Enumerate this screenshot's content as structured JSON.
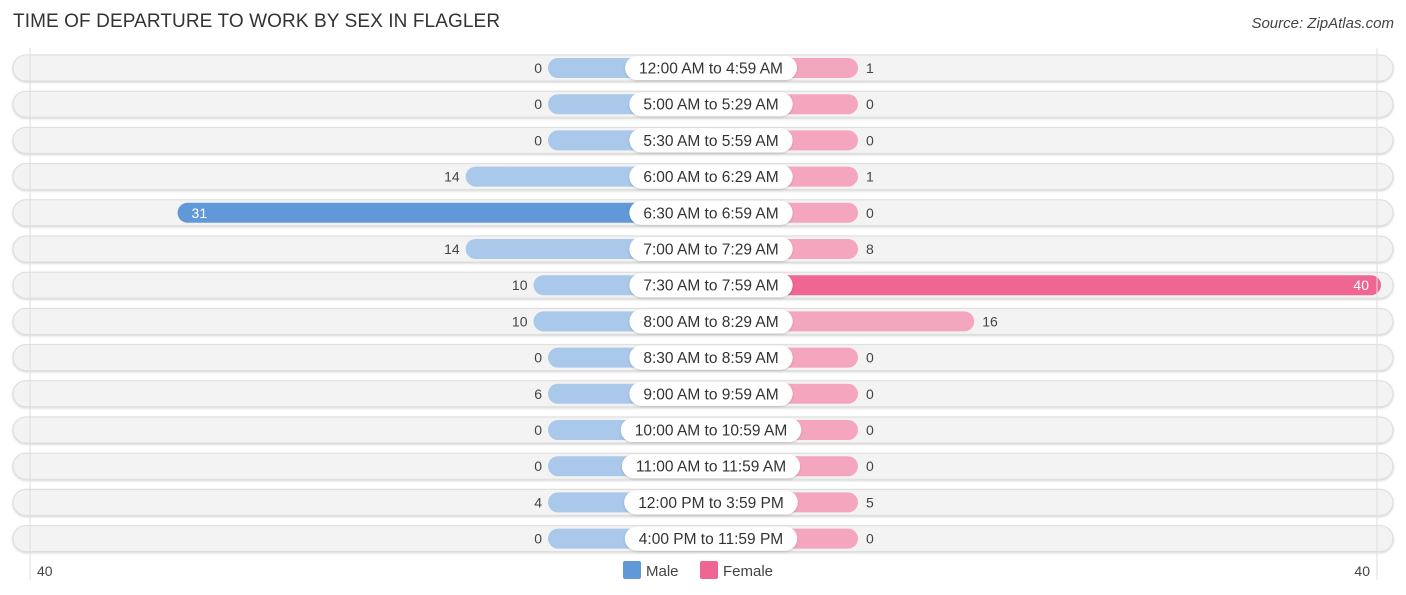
{
  "header": {
    "title": "TIME OF DEPARTURE TO WORK BY SEX IN FLAGLER",
    "source": "Source: ZipAtlas.com"
  },
  "colors": {
    "male_light": "#a9c8ea",
    "male_strong": "#6199d8",
    "female_light": "#f5a6bf",
    "female_strong": "#f06692",
    "row_bg": "#f3f3f3"
  },
  "chart_data": {
    "type": "bar",
    "orientation": "horizontal-diverging",
    "title": "TIME OF DEPARTURE TO WORK BY SEX IN FLAGLER",
    "categories": [
      "12:00 AM to 4:59 AM",
      "5:00 AM to 5:29 AM",
      "5:30 AM to 5:59 AM",
      "6:00 AM to 6:29 AM",
      "6:30 AM to 6:59 AM",
      "7:00 AM to 7:29 AM",
      "7:30 AM to 7:59 AM",
      "8:00 AM to 8:29 AM",
      "8:30 AM to 8:59 AM",
      "9:00 AM to 9:59 AM",
      "10:00 AM to 10:59 AM",
      "11:00 AM to 11:59 AM",
      "12:00 PM to 3:59 PM",
      "4:00 PM to 11:59 PM"
    ],
    "series": [
      {
        "name": "Male",
        "values": [
          0,
          0,
          0,
          14,
          31,
          14,
          10,
          10,
          0,
          6,
          0,
          0,
          4,
          0
        ]
      },
      {
        "name": "Female",
        "values": [
          1,
          0,
          0,
          1,
          0,
          8,
          40,
          16,
          0,
          0,
          0,
          0,
          5,
          0
        ]
      }
    ],
    "xlim": [
      40,
      40
    ],
    "axis_labels": {
      "left": "40",
      "right": "40"
    },
    "legend": {
      "position": "bottom-center",
      "entries": [
        "Male",
        "Female"
      ]
    }
  }
}
